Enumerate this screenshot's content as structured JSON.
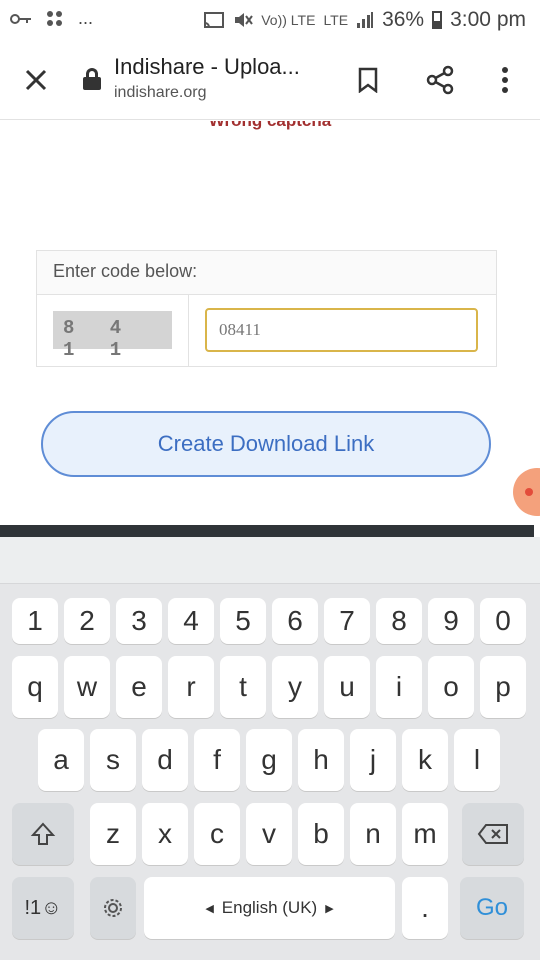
{
  "status_bar": {
    "key_icon": "key-icon",
    "apps_icon": "apps-grid-icon",
    "ellipsis": "...",
    "battery_percent": "36%",
    "time": "3:00 pm",
    "volte": "Vo)) LTE",
    "lte": "LTE"
  },
  "toolbar": {
    "title": "Indishare - Uploa...",
    "url": "indishare.org"
  },
  "page": {
    "error_text": "Wrong captcha",
    "captcha_label": "Enter code below:",
    "captcha_code": "8 4 1 1",
    "captcha_value": "08411",
    "create_button": "Create Download Link"
  },
  "keyboard": {
    "row_numbers": [
      "1",
      "2",
      "3",
      "4",
      "5",
      "6",
      "7",
      "8",
      "9",
      "0"
    ],
    "row_1": [
      "q",
      "w",
      "e",
      "r",
      "t",
      "y",
      "u",
      "i",
      "o",
      "p"
    ],
    "row_2": [
      "a",
      "s",
      "d",
      "f",
      "g",
      "h",
      "j",
      "k",
      "l"
    ],
    "row_3": [
      "z",
      "x",
      "c",
      "v",
      "b",
      "n",
      "m"
    ],
    "symbols_key": "!1☺",
    "space_label": "English (UK)",
    "period_key": ".",
    "go_key": "Go"
  },
  "colors": {
    "error": "#a23030",
    "button_border": "#5f8dd6",
    "button_bg": "#e8f1fc",
    "input_border": "#d9b54a",
    "go_key": "#2f8fd8"
  }
}
